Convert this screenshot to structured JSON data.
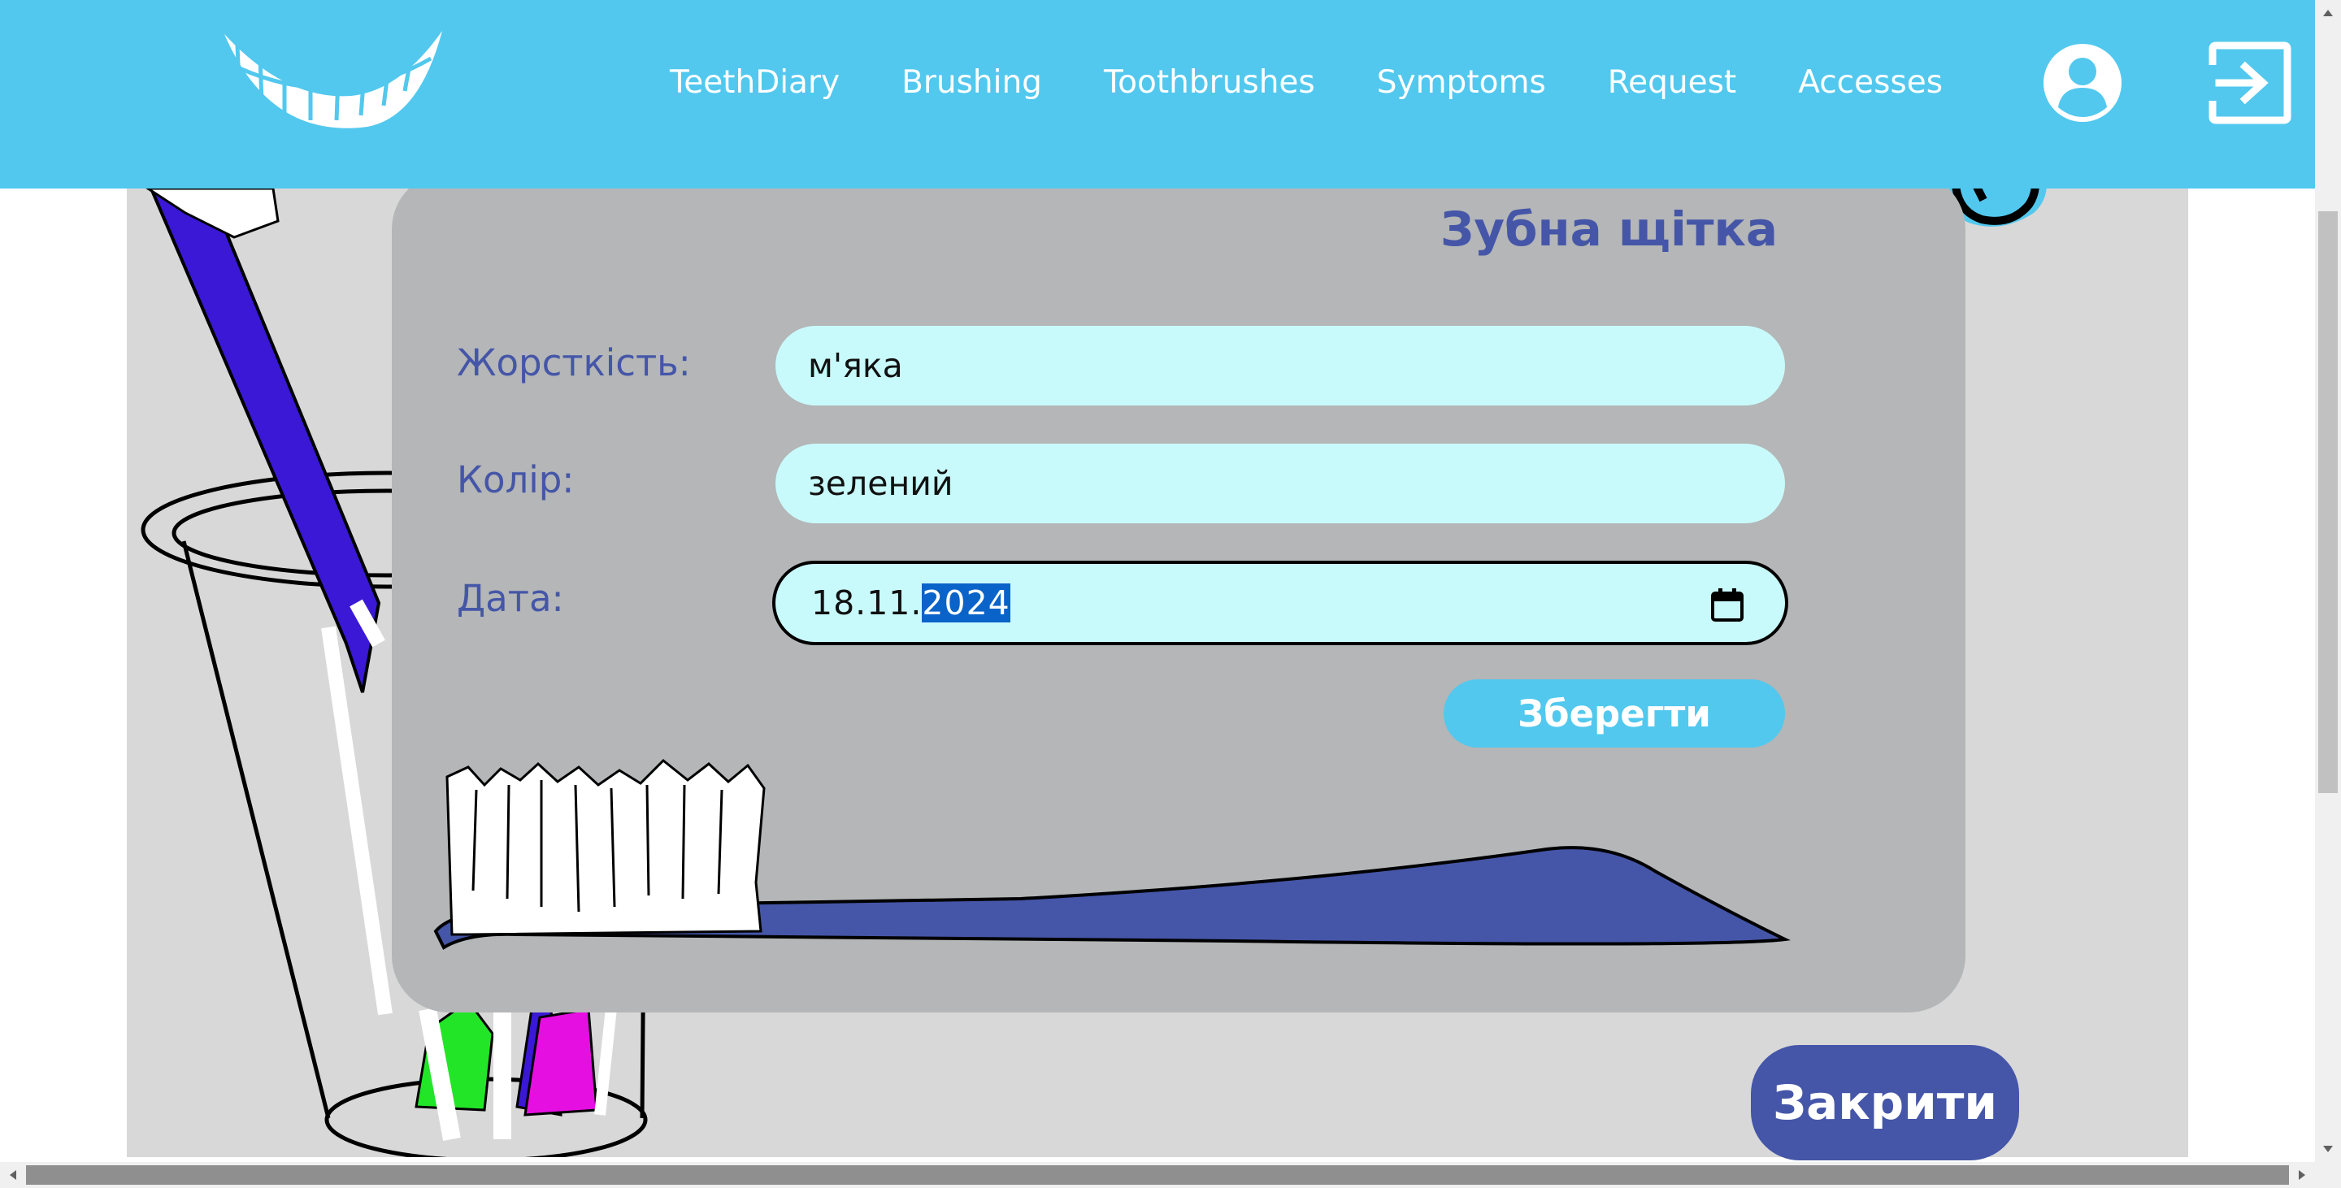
{
  "header": {
    "nav": [
      "TeethDiary",
      "Brushing",
      "Toothbrushes",
      "Symptoms",
      "Request",
      "Accesses"
    ]
  },
  "modal": {
    "title": "Зубна щітка",
    "fields": {
      "hardness": {
        "label": "Жорсткість:",
        "value": "м'яка"
      },
      "color": {
        "label": "Колір:",
        "value": "зелений"
      },
      "date": {
        "label": "Дата:",
        "value_prefix": "18.11.",
        "value_year": "2024"
      }
    },
    "save_label": "Зберегти"
  },
  "close_label": "Закрити",
  "colors": {
    "header_bg": "#52c8ee",
    "accent_text": "#4556a8",
    "modal_bg": "#b4b6b7",
    "input_bg": "#c9fafb",
    "scene_bg": "#d8d8d8"
  },
  "icons": [
    "teeth-smile-logo",
    "user-icon",
    "logout-icon",
    "calendar-icon",
    "round-arrow-icon"
  ]
}
